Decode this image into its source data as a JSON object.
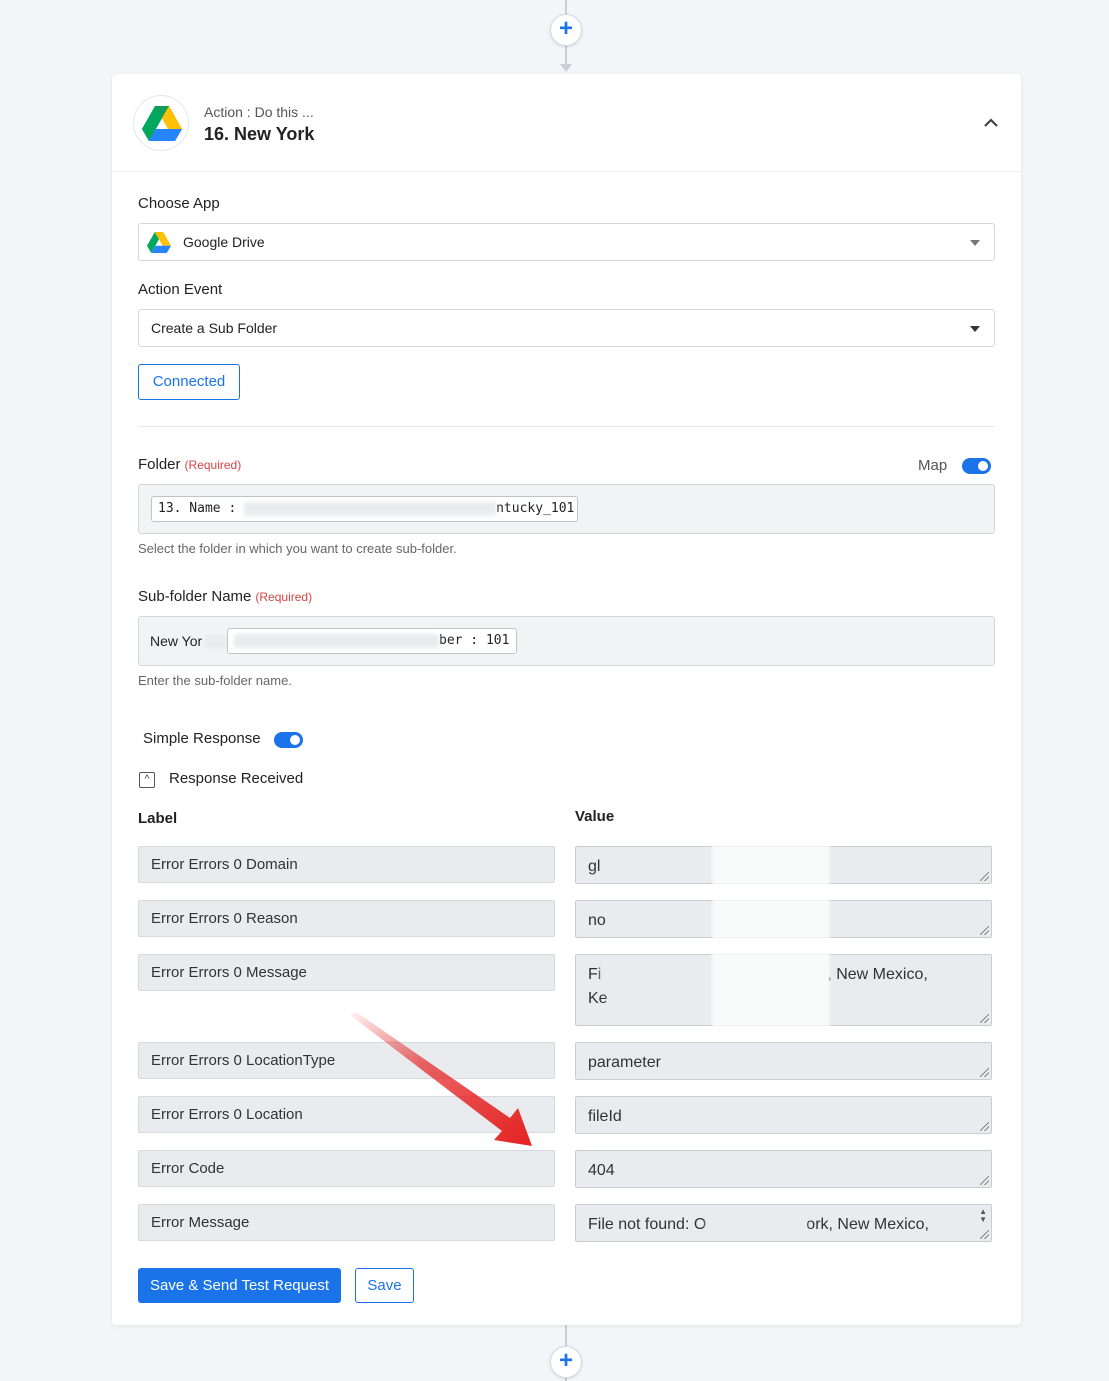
{
  "step": {
    "subtitle": "Action : Do this ...",
    "title": "16. New York",
    "logo_icon": "google-drive-icon"
  },
  "choose_app": {
    "label": "Choose App",
    "value": "Google Drive"
  },
  "action_event": {
    "label": "Action Event",
    "value": "Create a Sub Folder"
  },
  "connection": {
    "label": "Connected"
  },
  "folder": {
    "label": "Folder",
    "required": "(Required)",
    "map_label": "Map",
    "map_enabled": true,
    "chip_prefix": "13. Name :",
    "chip_suffix": "ntucky_101",
    "help": "Select the folder in which you want to create sub-folder."
  },
  "subfolder": {
    "label": "Sub-folder Name",
    "required": "(Required)",
    "prefix": "New Yor",
    "chip_suffix": "ber : 101",
    "help": "Enter the sub-folder name."
  },
  "simple_response": {
    "label": "Simple Response",
    "enabled": true
  },
  "response": {
    "toggle_symbol": "^",
    "title": "Response Received",
    "label_header": "Label",
    "value_header": "Value",
    "rows": [
      {
        "label": "Error Errors 0 Domain",
        "value": "gl"
      },
      {
        "label": "Error Errors 0 Reason",
        "value": "no"
      },
      {
        "label": "Error Errors 0 Message",
        "value_line1_start": "Fi",
        "value_line1_end": ", New Mexico,",
        "value_line2": "Ke"
      },
      {
        "label": "Error Errors 0 LocationType",
        "value": "parameter"
      },
      {
        "label": "Error Errors 0 Location",
        "value": "fileId"
      },
      {
        "label": "Error Code",
        "value": "404"
      },
      {
        "label": "Error Message",
        "value_start": "File not found: O",
        "value_end": "ork, New Mexico,"
      }
    ]
  },
  "buttons": {
    "save_and_test": "Save & Send Test Request",
    "save": "Save"
  },
  "colors": {
    "accent": "#1a73e8",
    "required": "#d64545",
    "annotation_arrow": "#e52222"
  },
  "icons": {
    "add_step_top": "plus-icon",
    "add_step_bottom": "plus-icon",
    "collapse": "chevron-up-icon"
  }
}
